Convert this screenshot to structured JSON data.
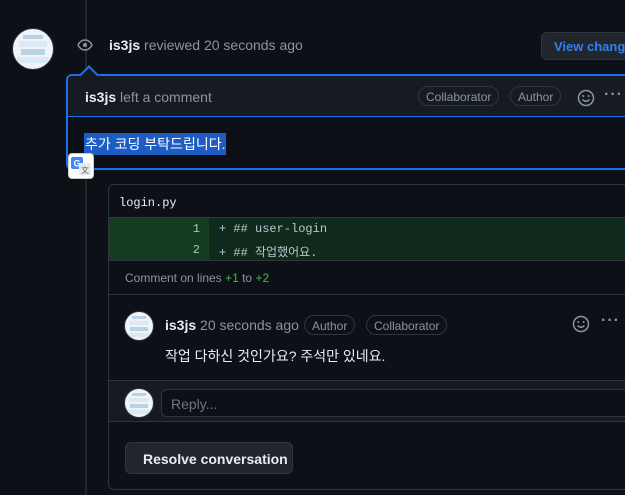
{
  "review": {
    "user": "is3js",
    "action": "reviewed",
    "time": "20 seconds ago",
    "view_changes_label": "View changes"
  },
  "comment": {
    "user": "is3js",
    "action": "left a comment",
    "badges": [
      "Collaborator",
      "Author"
    ],
    "body": "추가 코딩 부탁드립니다.",
    "more_label": "···"
  },
  "file": {
    "name": "login.py",
    "diff": [
      {
        "line": "1",
        "code": "+ ## user-login"
      },
      {
        "line": "2",
        "code": "+ ## 작업했어요."
      }
    ],
    "lines_note": {
      "prefix": "Comment on lines",
      "from": "+1",
      "to_word": "to",
      "to": "+2"
    }
  },
  "reply": {
    "user": "is3js",
    "time": "20 seconds ago",
    "badges": [
      "Author",
      "Collaborator"
    ],
    "body": "작업 다하신 것인가요? 주석만 있네요.",
    "more_label": "···"
  },
  "reply_box": {
    "placeholder": "Reply..."
  },
  "resolve_label": "Resolve conversation",
  "colors": {
    "accent": "#1f6feb",
    "link": "#2f81f7",
    "added": "#3fb950",
    "background": "#0d1117"
  },
  "icons": [
    "eye-icon",
    "smiley-icon",
    "kebab-icon",
    "google-translate-icon"
  ]
}
